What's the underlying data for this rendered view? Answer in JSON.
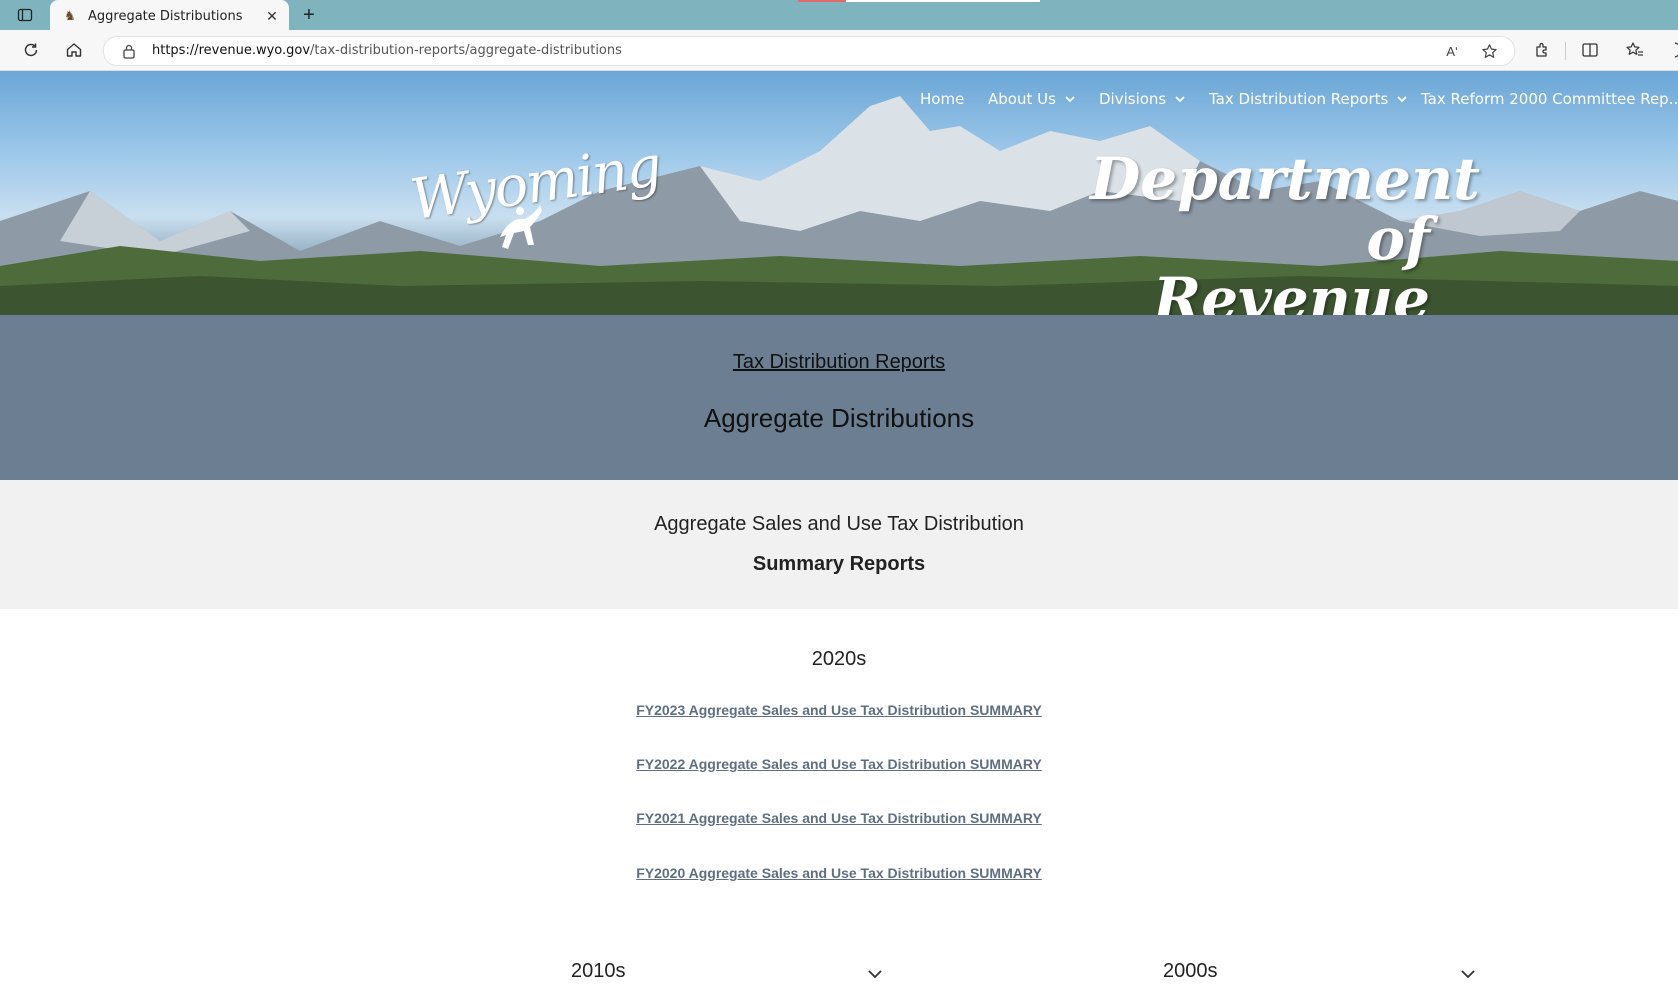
{
  "browser": {
    "tab_title": "Aggregate Distributions",
    "url_host": "https://revenue.wyo.gov",
    "url_path": "/tax-distribution-reports/aggregate-distributions",
    "read_aloud_label": "Aʹ"
  },
  "nav": {
    "items": [
      {
        "label": "Home"
      },
      {
        "label": "About Us"
      },
      {
        "label": "Divisions"
      },
      {
        "label": "Tax Distribution Reports"
      },
      {
        "label": "Tax Reform 2000 Committee Rep..."
      }
    ]
  },
  "hero": {
    "logo_text": "Wyoming",
    "dept_line1": "Department",
    "dept_line2": "of Revenue"
  },
  "header": {
    "breadcrumb": "Tax Distribution Reports",
    "title": "Aggregate Distributions"
  },
  "section": {
    "heading": "Aggregate Sales and Use Tax Distribution",
    "subheading": "Summary Reports"
  },
  "decades": {
    "current": "2020s",
    "links": [
      "FY2023 Aggregate Sales and Use Tax Distribution SUMMARY",
      "FY2022 Aggregate Sales and Use Tax Distribution SUMMARY",
      "FY2021 Aggregate Sales and Use Tax Distribution SUMMARY",
      "FY2020 Aggregate Sales and Use Tax Distribution SUMMARY"
    ],
    "collapsed": [
      "2010s",
      "2000s"
    ]
  },
  "colors": {
    "tabbar": "#7fb3bd",
    "band": "#6c7f92",
    "subband": "#f1f1f1",
    "link": "#5f6f80"
  }
}
